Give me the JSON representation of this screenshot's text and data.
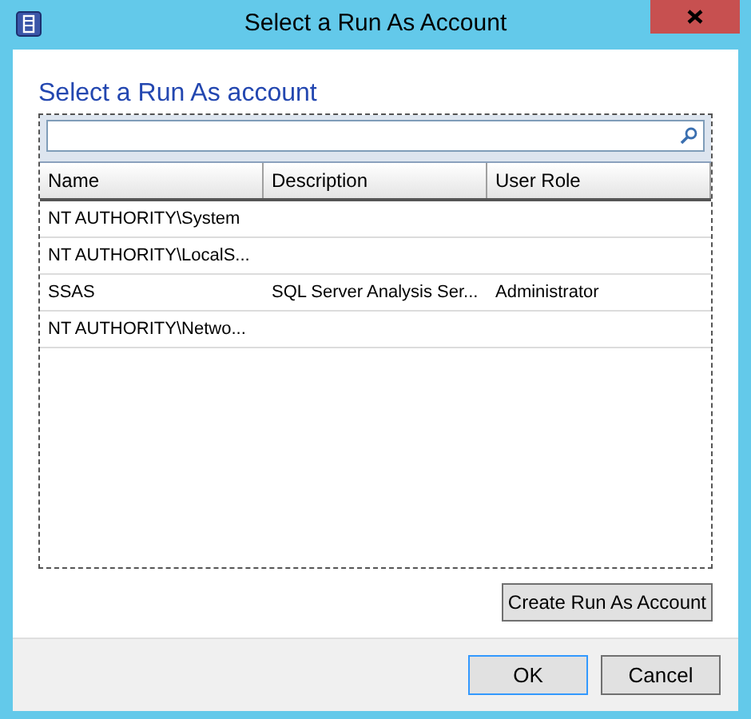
{
  "window": {
    "title": "Select a Run As Account"
  },
  "heading": "Select a Run As account",
  "table": {
    "columns": [
      "Name",
      "Description",
      "User Role"
    ],
    "rows": [
      {
        "cells": [
          "NT AUTHORITY\\System",
          "",
          ""
        ],
        "selected": false
      },
      {
        "cells": [
          "NT AUTHORITY\\LocalS...",
          "",
          ""
        ],
        "selected": false
      },
      {
        "cells": [
          "SSAS",
          "SQL Server Analysis Ser...",
          "Administrator"
        ],
        "selected": false
      },
      {
        "cells": [
          "NT AUTHORITY\\Netwo...",
          "",
          ""
        ],
        "selected": false
      }
    ]
  },
  "create_button": "Create Run As Account",
  "buttons": [
    {
      "label": "OK",
      "kind": "default"
    },
    {
      "label": "Cancel",
      "kind": "normal"
    }
  ]
}
